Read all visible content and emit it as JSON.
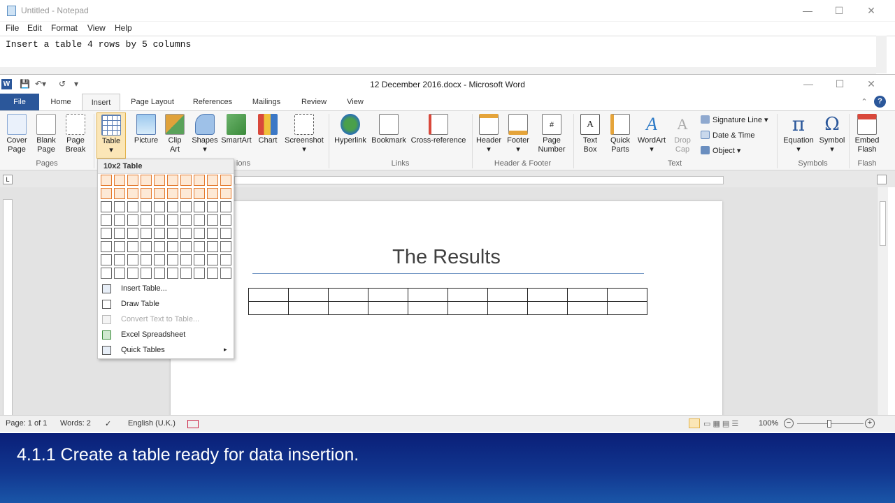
{
  "notepad": {
    "title": "Untitled - Notepad",
    "menu": [
      "File",
      "Edit",
      "Format",
      "View",
      "Help"
    ],
    "content": "Insert a table 4 rows by 5 columns"
  },
  "word": {
    "title": "12 December 2016.docx  -  Microsoft Word",
    "tabs": [
      "File",
      "Home",
      "Insert",
      "Page Layout",
      "References",
      "Mailings",
      "Review",
      "View"
    ],
    "active_tab": "Insert",
    "ribbon": {
      "pages": {
        "cover": "Cover",
        "cover2": "Page",
        "blank": "Blank",
        "blank2": "Page",
        "break": "Page",
        "break2": "Break",
        "group": "Pages"
      },
      "table_label": "Table",
      "picture": "Picture",
      "clip": "Clip",
      "clip2": "Art",
      "shapes": "Shapes",
      "smartart": "SmartArt",
      "chart": "Chart",
      "screenshot": "Screenshot",
      "illus_group": "ions",
      "hyperlink": "Hyperlink",
      "bookmark": "Bookmark",
      "crossref": "Cross-reference",
      "links_group": "Links",
      "header": "Header",
      "footer": "Footer",
      "pagenum": "Page",
      "pagenum2": "Number",
      "hf_group": "Header & Footer",
      "textbox": "Text",
      "textbox2": "Box",
      "quickparts": "Quick",
      "quickparts2": "Parts",
      "wordart": "WordArt",
      "dropcap": "Drop",
      "dropcap2": "Cap",
      "sigline": "Signature Line",
      "datetime": "Date & Time",
      "object": "Object",
      "text_group": "Text",
      "equation": "Equation",
      "symbol": "Symbol",
      "symbols_group": "Symbols",
      "embed": "Embed",
      "embed2": "Flash",
      "flash_group": "Flash"
    },
    "dropdown": {
      "header": "10x2 Table",
      "grid_cols": 10,
      "grid_rows": 8,
      "selected_cols": 10,
      "selected_rows": 2,
      "items": [
        {
          "label": "Insert Table...",
          "enabled": true
        },
        {
          "label": "Draw Table",
          "enabled": true
        },
        {
          "label": "Convert Text to Table...",
          "enabled": false
        },
        {
          "label": "Excel Spreadsheet",
          "enabled": true
        },
        {
          "label": "Quick Tables",
          "enabled": true
        }
      ]
    },
    "document": {
      "title": "The Results",
      "table_cols": 10,
      "table_rows": 2
    },
    "status": {
      "page": "Page: 1 of 1",
      "words": "Words: 2",
      "language": "English (U.K.)",
      "zoom": "100%"
    }
  },
  "banner": {
    "caption": "4.1.1 Create a table ready for data insertion."
  },
  "colors": {
    "word_blue": "#2b579a",
    "grid_highlight": "#e3792d",
    "banner": "#0a1f78"
  }
}
